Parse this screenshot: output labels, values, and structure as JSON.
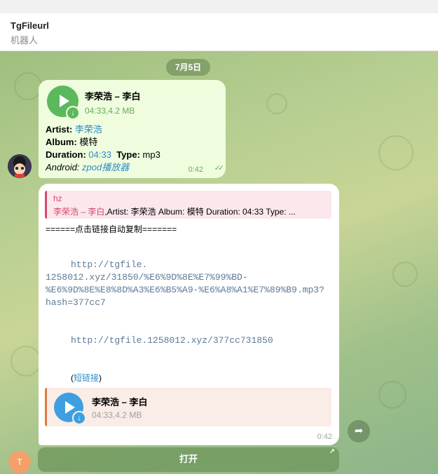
{
  "header": {
    "title": "TgFileurl",
    "subtitle": "机器人"
  },
  "date_pill": "7月5日",
  "message1": {
    "audio_title": "李荣浩 – 李白",
    "audio_meta": "04:33,4.2 MB",
    "artist_label": "Artist:",
    "artist_value": "李荣浩",
    "album_label": "Album:",
    "album_value": "模特",
    "duration_label": "Duration:",
    "duration_value": "04:33",
    "type_label": "Type:",
    "type_value": "mp3",
    "android_label": "Android:",
    "android_value": "zpod播放器",
    "time": "0:42",
    "read_checks": "✓✓"
  },
  "message2": {
    "reply_name": "hz",
    "reply_link": "李荣浩 – 李白",
    "reply_rest": ",Artist: 李荣浩 Album: 模特 Duration: 04:33  Type: ...",
    "copy_line": "======点击链接自动复制=======",
    "url_long_1": "http://tgfile.",
    "url_long_2": "1258012.xyz/31850/%E6%9D%8E%E7%99%BD-",
    "url_long_3": "%E6%9D%8E%E8%8D%A3%E6%B5%A9-%E6%A8%A1%E7%89%B9.mp3?",
    "url_long_4": "hash=377cc7",
    "url_short": "http://tgfile.1258012.xyz/377cc731850",
    "shortlink_open": "(",
    "shortlink_text": "短链接",
    "shortlink_close": ")",
    "card_title": "李荣浩 – 李白",
    "card_meta": "04:33,4.2 MB",
    "time": "0:42"
  },
  "avatar2_letter": "T",
  "open_button": "打开",
  "icons": {
    "download": "↓",
    "share": "➦",
    "open_arrow": "↗"
  },
  "colors": {
    "accent_green": "#5cb85c",
    "accent_blue": "#3e9fe0",
    "link": "#2e8bc9",
    "reply_pink": "#d6486f"
  }
}
